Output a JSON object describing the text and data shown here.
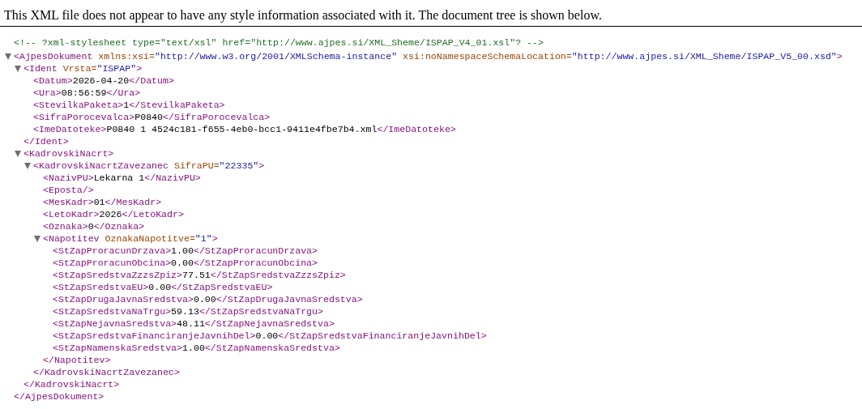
{
  "notice": "This XML file does not appear to have any style information associated with it. The document tree is shown below.",
  "comment": "<!-- ?xml-stylesheet type=\"text/xsl\" href=\"http://www.ajpes.si/XML_Sheme/ISPAP_V4_01.xsl\"? -->",
  "tree": {
    "open": [
      {
        "kind": "tag",
        "text": "<AjpesDokument"
      },
      {
        "kind": "attr",
        "text": " xmlns:xsi="
      },
      {
        "kind": "value",
        "text": "\"http://www.w3.org/2001/XMLSchema-instance\""
      },
      {
        "kind": "attr",
        "text": " xsi:noNamespaceSchemaLocation="
      },
      {
        "kind": "value",
        "text": "\"http://www.ajpes.si/XML_Sheme/ISPAP_V5_00.xsd\""
      },
      {
        "kind": "tag",
        "text": ">"
      }
    ],
    "expanded": true,
    "close": [
      {
        "kind": "tag",
        "text": "</AjpesDokument>"
      }
    ],
    "children": [
      {
        "open": [
          {
            "kind": "tag",
            "text": "<Ident"
          },
          {
            "kind": "attr",
            "text": " Vrsta="
          },
          {
            "kind": "value",
            "text": "\"ISPAP\""
          },
          {
            "kind": "tag",
            "text": ">"
          }
        ],
        "expanded": true,
        "close": [
          {
            "kind": "tag",
            "text": "</Ident>"
          }
        ],
        "children": [
          {
            "open": [
              {
                "kind": "tag",
                "text": "<Datum>"
              },
              {
                "kind": "text",
                "text": "2026-04-20"
              },
              {
                "kind": "tag",
                "text": "</Datum>"
              }
            ]
          },
          {
            "open": [
              {
                "kind": "tag",
                "text": "<Ura>"
              },
              {
                "kind": "text",
                "text": "08:56:59"
              },
              {
                "kind": "tag",
                "text": "</Ura>"
              }
            ]
          },
          {
            "open": [
              {
                "kind": "tag",
                "text": "<StevilkaPaketa>"
              },
              {
                "kind": "text",
                "text": "1"
              },
              {
                "kind": "tag",
                "text": "</StevilkaPaketa>"
              }
            ]
          },
          {
            "open": [
              {
                "kind": "tag",
                "text": "<SifraPorocevalca>"
              },
              {
                "kind": "text",
                "text": "P0840"
              },
              {
                "kind": "tag",
                "text": "</SifraPorocevalca>"
              }
            ]
          },
          {
            "open": [
              {
                "kind": "tag",
                "text": "<ImeDatoteke>"
              },
              {
                "kind": "text",
                "text": "P0840 1 4524c181-f655-4eb0-bcc1-9411e4fbe7b4.xml"
              },
              {
                "kind": "tag",
                "text": "</ImeDatoteke>"
              }
            ]
          }
        ]
      },
      {
        "open": [
          {
            "kind": "tag",
            "text": "<KadrovskiNacrt>"
          }
        ],
        "expanded": true,
        "close": [
          {
            "kind": "tag",
            "text": "</KadrovskiNacrt>"
          }
        ],
        "children": [
          {
            "open": [
              {
                "kind": "tag",
                "text": "<KadrovskiNacrtZavezanec"
              },
              {
                "kind": "attr",
                "text": " SifraPU="
              },
              {
                "kind": "value",
                "text": "\"22335\""
              },
              {
                "kind": "tag",
                "text": ">"
              }
            ],
            "expanded": true,
            "close": [
              {
                "kind": "tag",
                "text": "</KadrovskiNacrtZavezanec>"
              }
            ],
            "children": [
              {
                "open": [
                  {
                    "kind": "tag",
                    "text": "<NazivPU>"
                  },
                  {
                    "kind": "text",
                    "text": "Lekarna 1"
                  },
                  {
                    "kind": "tag",
                    "text": "</NazivPU>"
                  }
                ]
              },
              {
                "open": [
                  {
                    "kind": "tag",
                    "text": "<Eposta/>"
                  }
                ]
              },
              {
                "open": [
                  {
                    "kind": "tag",
                    "text": "<MesKadr>"
                  },
                  {
                    "kind": "text",
                    "text": "01"
                  },
                  {
                    "kind": "tag",
                    "text": "</MesKadr>"
                  }
                ]
              },
              {
                "open": [
                  {
                    "kind": "tag",
                    "text": "<LetoKadr>"
                  },
                  {
                    "kind": "text",
                    "text": "2026"
                  },
                  {
                    "kind": "tag",
                    "text": "</LetoKadr>"
                  }
                ]
              },
              {
                "open": [
                  {
                    "kind": "tag",
                    "text": "<Oznaka>"
                  },
                  {
                    "kind": "text",
                    "text": "0"
                  },
                  {
                    "kind": "tag",
                    "text": "</Oznaka>"
                  }
                ]
              },
              {
                "open": [
                  {
                    "kind": "tag",
                    "text": "<Napotitev"
                  },
                  {
                    "kind": "attr",
                    "text": " OznakaNapotitve="
                  },
                  {
                    "kind": "value",
                    "text": "\"1\""
                  },
                  {
                    "kind": "tag",
                    "text": ">"
                  }
                ],
                "expanded": true,
                "close": [
                  {
                    "kind": "tag",
                    "text": "</Napotitev>"
                  }
                ],
                "children": [
                  {
                    "open": [
                      {
                        "kind": "tag",
                        "text": "<StZapProracunDrzava>"
                      },
                      {
                        "kind": "text",
                        "text": "1.00"
                      },
                      {
                        "kind": "tag",
                        "text": "</StZapProracunDrzava>"
                      }
                    ]
                  },
                  {
                    "open": [
                      {
                        "kind": "tag",
                        "text": "<StZapProracunObcina>"
                      },
                      {
                        "kind": "text",
                        "text": "0.00"
                      },
                      {
                        "kind": "tag",
                        "text": "</StZapProracunObcina>"
                      }
                    ]
                  },
                  {
                    "open": [
                      {
                        "kind": "tag",
                        "text": "<StZapSredstvaZzzsZpiz>"
                      },
                      {
                        "kind": "text",
                        "text": "77.51"
                      },
                      {
                        "kind": "tag",
                        "text": "</StZapSredstvaZzzsZpiz>"
                      }
                    ]
                  },
                  {
                    "open": [
                      {
                        "kind": "tag",
                        "text": "<StZapSredstvaEU>"
                      },
                      {
                        "kind": "text",
                        "text": "0.00"
                      },
                      {
                        "kind": "tag",
                        "text": "</StZapSredstvaEU>"
                      }
                    ]
                  },
                  {
                    "open": [
                      {
                        "kind": "tag",
                        "text": "<StZapDrugaJavnaSredstva>"
                      },
                      {
                        "kind": "text",
                        "text": "0.00"
                      },
                      {
                        "kind": "tag",
                        "text": "</StZapDrugaJavnaSredstva>"
                      }
                    ]
                  },
                  {
                    "open": [
                      {
                        "kind": "tag",
                        "text": "<StZapSredstvaNaTrgu>"
                      },
                      {
                        "kind": "text",
                        "text": "59.13"
                      },
                      {
                        "kind": "tag",
                        "text": "</StZapSredstvaNaTrgu>"
                      }
                    ]
                  },
                  {
                    "open": [
                      {
                        "kind": "tag",
                        "text": "<StZapNejavnaSredstva>"
                      },
                      {
                        "kind": "text",
                        "text": "48.11"
                      },
                      {
                        "kind": "tag",
                        "text": "</StZapNejavnaSredstva>"
                      }
                    ]
                  },
                  {
                    "open": [
                      {
                        "kind": "tag",
                        "text": "<StZapSredstvaFinanciranjeJavnihDel>"
                      },
                      {
                        "kind": "text",
                        "text": "0.00"
                      },
                      {
                        "kind": "tag",
                        "text": "</StZapSredstvaFinanciranjeJavnihDel>"
                      }
                    ]
                  },
                  {
                    "open": [
                      {
                        "kind": "tag",
                        "text": "<StZapNamenskaSredstva>"
                      },
                      {
                        "kind": "text",
                        "text": "1.00"
                      },
                      {
                        "kind": "tag",
                        "text": "</StZapNamenskaSredstva>"
                      }
                    ]
                  }
                ]
              }
            ]
          }
        ]
      }
    ]
  }
}
